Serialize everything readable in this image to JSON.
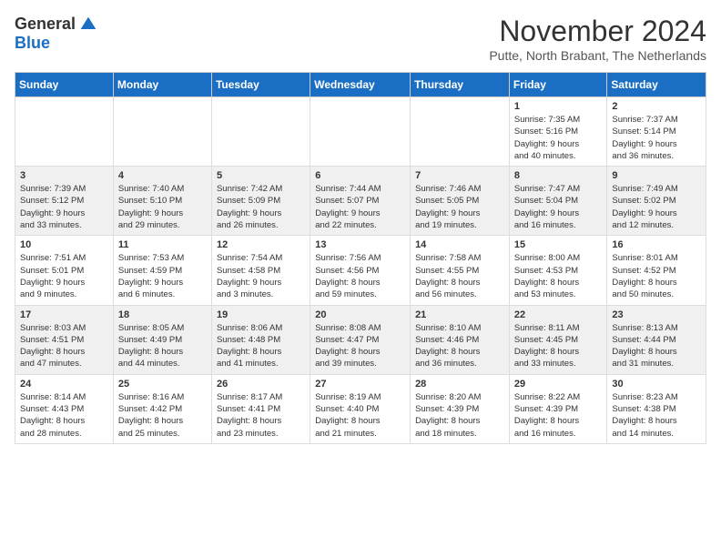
{
  "logo": {
    "general": "General",
    "blue": "Blue"
  },
  "title": "November 2024",
  "location": "Putte, North Brabant, The Netherlands",
  "days_header": [
    "Sunday",
    "Monday",
    "Tuesday",
    "Wednesday",
    "Thursday",
    "Friday",
    "Saturday"
  ],
  "weeks": [
    [
      {
        "day": "",
        "info": ""
      },
      {
        "day": "",
        "info": ""
      },
      {
        "day": "",
        "info": ""
      },
      {
        "day": "",
        "info": ""
      },
      {
        "day": "",
        "info": ""
      },
      {
        "day": "1",
        "info": "Sunrise: 7:35 AM\nSunset: 5:16 PM\nDaylight: 9 hours\nand 40 minutes."
      },
      {
        "day": "2",
        "info": "Sunrise: 7:37 AM\nSunset: 5:14 PM\nDaylight: 9 hours\nand 36 minutes."
      }
    ],
    [
      {
        "day": "3",
        "info": "Sunrise: 7:39 AM\nSunset: 5:12 PM\nDaylight: 9 hours\nand 33 minutes."
      },
      {
        "day": "4",
        "info": "Sunrise: 7:40 AM\nSunset: 5:10 PM\nDaylight: 9 hours\nand 29 minutes."
      },
      {
        "day": "5",
        "info": "Sunrise: 7:42 AM\nSunset: 5:09 PM\nDaylight: 9 hours\nand 26 minutes."
      },
      {
        "day": "6",
        "info": "Sunrise: 7:44 AM\nSunset: 5:07 PM\nDaylight: 9 hours\nand 22 minutes."
      },
      {
        "day": "7",
        "info": "Sunrise: 7:46 AM\nSunset: 5:05 PM\nDaylight: 9 hours\nand 19 minutes."
      },
      {
        "day": "8",
        "info": "Sunrise: 7:47 AM\nSunset: 5:04 PM\nDaylight: 9 hours\nand 16 minutes."
      },
      {
        "day": "9",
        "info": "Sunrise: 7:49 AM\nSunset: 5:02 PM\nDaylight: 9 hours\nand 12 minutes."
      }
    ],
    [
      {
        "day": "10",
        "info": "Sunrise: 7:51 AM\nSunset: 5:01 PM\nDaylight: 9 hours\nand 9 minutes."
      },
      {
        "day": "11",
        "info": "Sunrise: 7:53 AM\nSunset: 4:59 PM\nDaylight: 9 hours\nand 6 minutes."
      },
      {
        "day": "12",
        "info": "Sunrise: 7:54 AM\nSunset: 4:58 PM\nDaylight: 9 hours\nand 3 minutes."
      },
      {
        "day": "13",
        "info": "Sunrise: 7:56 AM\nSunset: 4:56 PM\nDaylight: 8 hours\nand 59 minutes."
      },
      {
        "day": "14",
        "info": "Sunrise: 7:58 AM\nSunset: 4:55 PM\nDaylight: 8 hours\nand 56 minutes."
      },
      {
        "day": "15",
        "info": "Sunrise: 8:00 AM\nSunset: 4:53 PM\nDaylight: 8 hours\nand 53 minutes."
      },
      {
        "day": "16",
        "info": "Sunrise: 8:01 AM\nSunset: 4:52 PM\nDaylight: 8 hours\nand 50 minutes."
      }
    ],
    [
      {
        "day": "17",
        "info": "Sunrise: 8:03 AM\nSunset: 4:51 PM\nDaylight: 8 hours\nand 47 minutes."
      },
      {
        "day": "18",
        "info": "Sunrise: 8:05 AM\nSunset: 4:49 PM\nDaylight: 8 hours\nand 44 minutes."
      },
      {
        "day": "19",
        "info": "Sunrise: 8:06 AM\nSunset: 4:48 PM\nDaylight: 8 hours\nand 41 minutes."
      },
      {
        "day": "20",
        "info": "Sunrise: 8:08 AM\nSunset: 4:47 PM\nDaylight: 8 hours\nand 39 minutes."
      },
      {
        "day": "21",
        "info": "Sunrise: 8:10 AM\nSunset: 4:46 PM\nDaylight: 8 hours\nand 36 minutes."
      },
      {
        "day": "22",
        "info": "Sunrise: 8:11 AM\nSunset: 4:45 PM\nDaylight: 8 hours\nand 33 minutes."
      },
      {
        "day": "23",
        "info": "Sunrise: 8:13 AM\nSunset: 4:44 PM\nDaylight: 8 hours\nand 31 minutes."
      }
    ],
    [
      {
        "day": "24",
        "info": "Sunrise: 8:14 AM\nSunset: 4:43 PM\nDaylight: 8 hours\nand 28 minutes."
      },
      {
        "day": "25",
        "info": "Sunrise: 8:16 AM\nSunset: 4:42 PM\nDaylight: 8 hours\nand 25 minutes."
      },
      {
        "day": "26",
        "info": "Sunrise: 8:17 AM\nSunset: 4:41 PM\nDaylight: 8 hours\nand 23 minutes."
      },
      {
        "day": "27",
        "info": "Sunrise: 8:19 AM\nSunset: 4:40 PM\nDaylight: 8 hours\nand 21 minutes."
      },
      {
        "day": "28",
        "info": "Sunrise: 8:20 AM\nSunset: 4:39 PM\nDaylight: 8 hours\nand 18 minutes."
      },
      {
        "day": "29",
        "info": "Sunrise: 8:22 AM\nSunset: 4:39 PM\nDaylight: 8 hours\nand 16 minutes."
      },
      {
        "day": "30",
        "info": "Sunrise: 8:23 AM\nSunset: 4:38 PM\nDaylight: 8 hours\nand 14 minutes."
      }
    ]
  ]
}
